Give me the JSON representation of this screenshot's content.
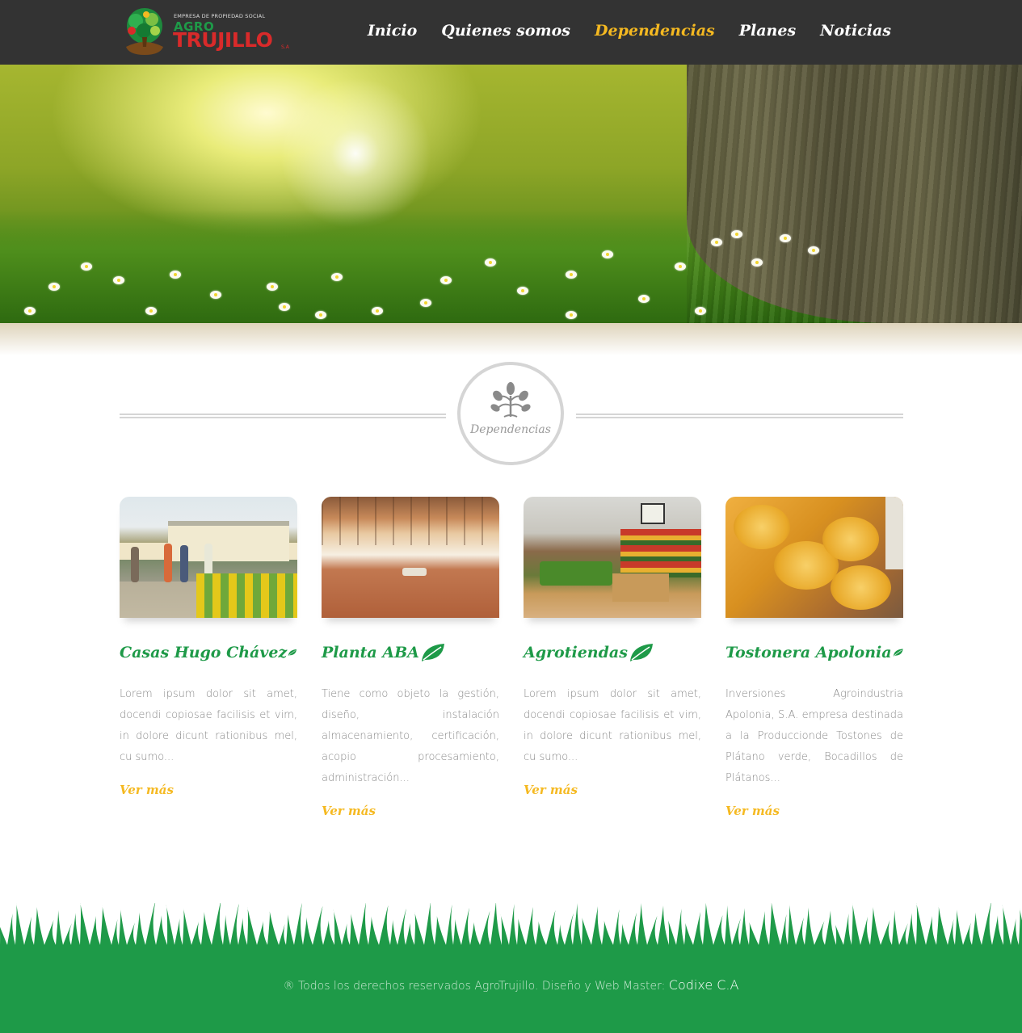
{
  "header": {
    "logo": {
      "small_text": "EMPRESA DE PROPIEDAD SOCIAL",
      "agro": "AGRO",
      "trujillo": "TRUJILLO",
      "sa": "S.A"
    },
    "nav": [
      {
        "label": "Inicio",
        "active": false
      },
      {
        "label": "Quienes somos",
        "active": false
      },
      {
        "label": "Dependencias",
        "active": true
      },
      {
        "label": "Planes",
        "active": false
      },
      {
        "label": "Noticias",
        "active": false
      }
    ]
  },
  "section": {
    "title": "Dependencias",
    "icon": "plant-icon"
  },
  "cards": [
    {
      "title": "Casas Hugo Chávez",
      "text": "Lorem ipsum dolor sit amet, docendi copiosae facilisis et vim, in dolore dicunt rationibus mel, cu sumo...",
      "more": "Ver más"
    },
    {
      "title": "Planta ABA",
      "text": "Tiene como objeto la gestión, diseño, instalación almacenamiento, certificación, acopio procesamiento, administración...",
      "more": "Ver más"
    },
    {
      "title": "Agrotiendas",
      "text": "Lorem ipsum dolor sit amet, docendi copiosae facilisis et vim, in dolore dicunt rationibus mel, cu sumo...",
      "more": "Ver más"
    },
    {
      "title": "Tostonera Apolonia",
      "text": "Inversiones Agroindustria Apolonia, S.A. empresa destinada a la Produccionde Tostones de Plátano verde, Bocadillos de Plátanos...",
      "more": "Ver más"
    }
  ],
  "footer": {
    "text": "® Todos los derechos reservados AgroTrujillo. Diseño y Web Master: ",
    "brand": "Codixe C.A"
  },
  "colors": {
    "header_bg": "#333333",
    "nav_active": "#f5b921",
    "brand_green": "#1e9a48",
    "brand_red": "#d92a2a",
    "accent_yellow": "#f5b921"
  }
}
